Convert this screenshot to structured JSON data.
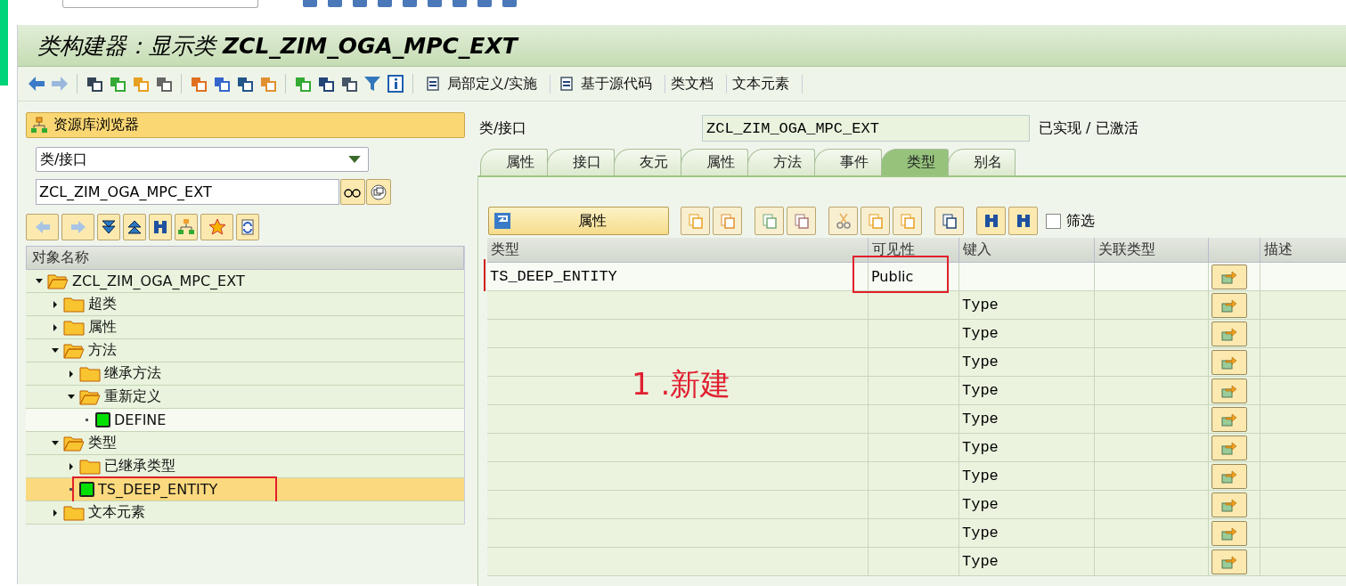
{
  "title": "类构建器：显示类 **ZCL_ZIM_OGA_MPC_EXT**",
  "toolbar": {
    "buttons": [
      "局部定义/实施",
      "基于源代码",
      "类文档",
      "文本元素"
    ]
  },
  "browser": {
    "title": "资源库浏览器",
    "object_type": "类/接口",
    "object_name": "ZCL_ZIM_OGA_MPC_EXT",
    "tree": {
      "header": "对象名称",
      "items": [
        {
          "label": "ZCL_ZIM_OGA_MPC_EXT",
          "kind": "folder",
          "expanded": true,
          "selected": false,
          "children": [
            {
              "label": "超类",
              "kind": "folder",
              "expanded": false,
              "selected": false
            },
            {
              "label": "属性",
              "kind": "folder",
              "expanded": false,
              "selected": false
            },
            {
              "label": "方法",
              "kind": "folder",
              "expanded": true,
              "selected": false,
              "children": [
                {
                  "label": "继承方法",
                  "kind": "folder",
                  "expanded": false,
                  "selected": false
                },
                {
                  "label": "重新定义",
                  "kind": "folder",
                  "expanded": true,
                  "selected": false,
                  "children": [
                    {
                      "label": "DEFINE",
                      "kind": "object",
                      "selected": false
                    }
                  ]
                }
              ]
            },
            {
              "label": "类型",
              "kind": "folder",
              "expanded": true,
              "selected": false,
              "children": [
                {
                  "label": "已继承类型",
                  "kind": "folder",
                  "expanded": false,
                  "selected": false
                },
                {
                  "label": "TS_DEEP_ENTITY",
                  "kind": "object",
                  "selected": true
                }
              ]
            },
            {
              "label": "文本元素",
              "kind": "folder",
              "expanded": false,
              "selected": false
            }
          ]
        }
      ]
    }
  },
  "header": {
    "label": "类/接口",
    "value": "ZCL_ZIM_OGA_MPC_EXT",
    "status": "已实现 / 已激活"
  },
  "tabs": [
    {
      "label": "属性",
      "selected": false
    },
    {
      "label": "接口",
      "selected": false
    },
    {
      "label": "友元",
      "selected": false
    },
    {
      "label": "属性",
      "selected": false
    },
    {
      "label": "方法",
      "selected": false
    },
    {
      "label": "事件",
      "selected": false
    },
    {
      "label": "类型",
      "selected": true
    },
    {
      "label": "别名",
      "selected": false
    }
  ],
  "table_toolbar": {
    "attributes_button": "属性",
    "filter": {
      "label": "筛选",
      "checked": false
    }
  },
  "table": {
    "columns": [
      "类型",
      "可见性",
      "键入",
      "关联类型",
      "描述"
    ],
    "rows": [
      {
        "type": "TS_DEEP_ENTITY",
        "visibility": "Public",
        "typing": ""
      },
      {
        "type": "",
        "visibility": "",
        "typing": "Type"
      },
      {
        "type": "",
        "visibility": "",
        "typing": "Type"
      },
      {
        "type": "",
        "visibility": "",
        "typing": "Type"
      },
      {
        "type": "",
        "visibility": "",
        "typing": "Type"
      },
      {
        "type": "",
        "visibility": "",
        "typing": "Type"
      },
      {
        "type": "",
        "visibility": "",
        "typing": "Type"
      },
      {
        "type": "",
        "visibility": "",
        "typing": "Type"
      },
      {
        "type": "",
        "visibility": "",
        "typing": "Type"
      },
      {
        "type": "",
        "visibility": "",
        "typing": "Type"
      },
      {
        "type": "",
        "visibility": "",
        "typing": "Type"
      }
    ]
  },
  "annotation": "1 .新建"
}
